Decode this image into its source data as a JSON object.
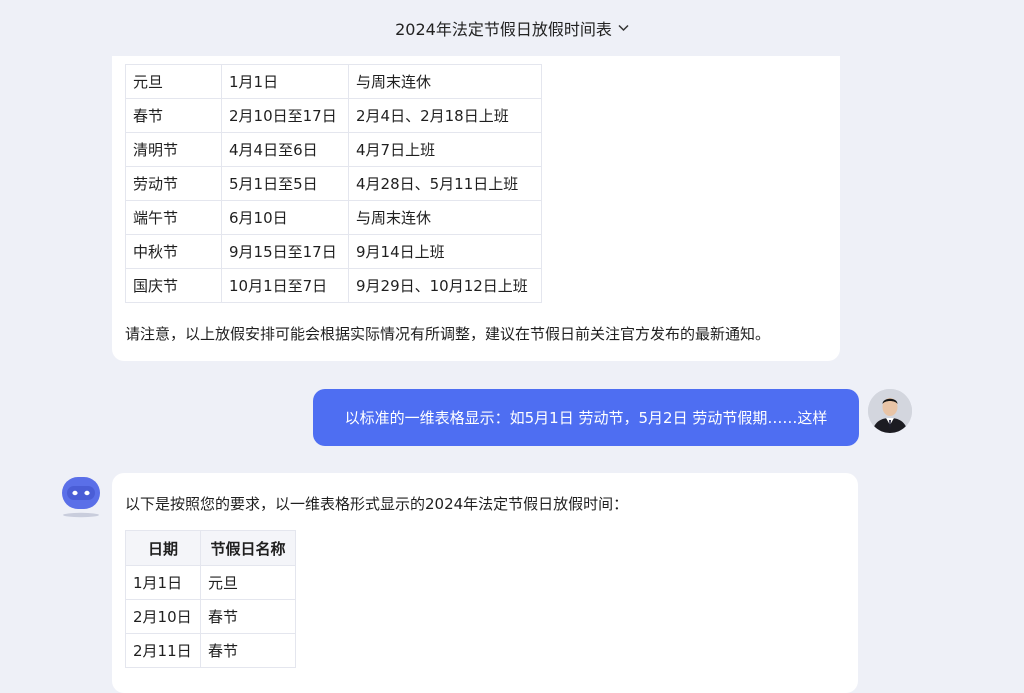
{
  "header": {
    "title": "2024年法定节假日放假时间表"
  },
  "bot_message_1": {
    "table_rows": [
      [
        "元旦",
        "1月1日",
        "与周末连休"
      ],
      [
        "春节",
        "2月10日至17日",
        "2月4日、2月18日上班"
      ],
      [
        "清明节",
        "4月4日至6日",
        "4月7日上班"
      ],
      [
        "劳动节",
        "5月1日至5日",
        "4月28日、5月11日上班"
      ],
      [
        "端午节",
        "6月10日",
        "与周末连休"
      ],
      [
        "中秋节",
        "9月15日至17日",
        "9月14日上班"
      ],
      [
        "国庆节",
        "10月1日至7日",
        "9月29日、10月12日上班"
      ]
    ],
    "note": "请注意，以上放假安排可能会根据实际情况有所调整，建议在节假日前关注官方发布的最新通知。"
  },
  "user_message": {
    "text": "以标准的一维表格显示：如5月1日 劳动节，5月2日 劳动节假期……这样"
  },
  "bot_message_2": {
    "intro": "以下是按照您的要求，以一维表格形式显示的2024年法定节假日放假时间：",
    "headers": [
      "日期",
      "节假日名称"
    ],
    "rows": [
      [
        "1月1日",
        "元旦"
      ],
      [
        "2月10日",
        "春节"
      ],
      [
        "2月11日",
        "春节"
      ]
    ]
  },
  "colors": {
    "user_bubble": "#4e6ef2",
    "page_bg": "#eef0f7",
    "bot_avatar": "#5a6fe8"
  },
  "icons": {
    "dropdown": "chevron-down-icon",
    "bot": "bot-avatar-icon",
    "user": "user-avatar"
  }
}
